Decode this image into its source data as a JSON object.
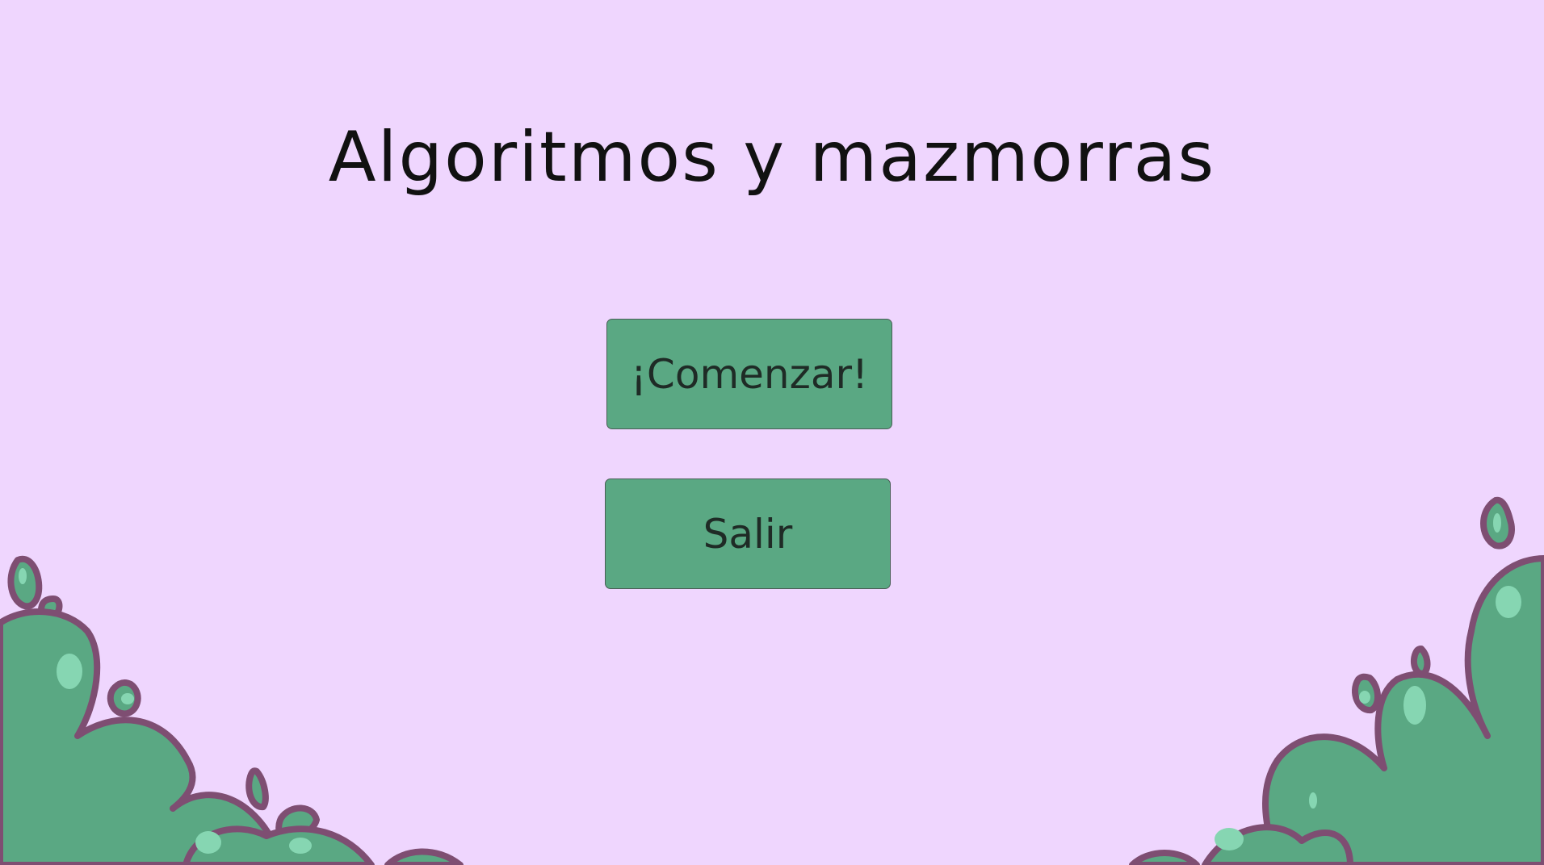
{
  "title": "Algoritmos y mazmorras",
  "menu": {
    "start_label": "¡Comenzar!",
    "exit_label": "Salir"
  },
  "colors": {
    "background": "#efd6fe",
    "button": "#5aa883",
    "bush_fill": "#5aa883",
    "bush_outline": "#7e4e72",
    "bush_highlight": "#86d6b2"
  },
  "decorations": {
    "left": "bush-left-decoration",
    "right": "bush-right-decoration"
  }
}
